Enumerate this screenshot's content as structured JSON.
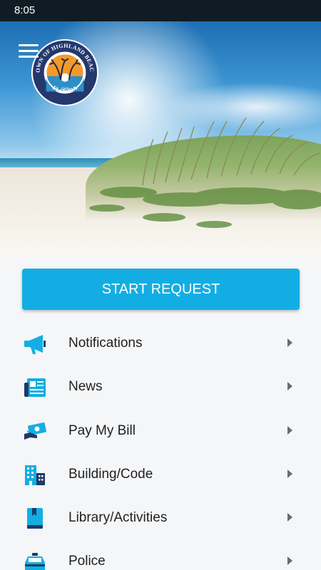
{
  "status_bar": {
    "time": "8:05"
  },
  "header": {
    "seal": {
      "top_text": "TOWN OF HIGHLAND BEACH",
      "bottom_text": "FLORIDA",
      "year": "1949"
    }
  },
  "actions": {
    "start_request_label": "START REQUEST"
  },
  "menu": {
    "items": [
      {
        "label": "Notifications",
        "icon": "megaphone-icon"
      },
      {
        "label": "News",
        "icon": "newspaper-icon"
      },
      {
        "label": "Pay My Bill",
        "icon": "bill-payment-icon"
      },
      {
        "label": "Building/Code",
        "icon": "building-icon"
      },
      {
        "label": "Library/Activities",
        "icon": "book-icon"
      },
      {
        "label": "Police",
        "icon": "police-car-icon"
      }
    ]
  },
  "colors": {
    "accent": "#12aee3",
    "status_bar": "#0f1c25",
    "background": "#f5f6f8"
  }
}
